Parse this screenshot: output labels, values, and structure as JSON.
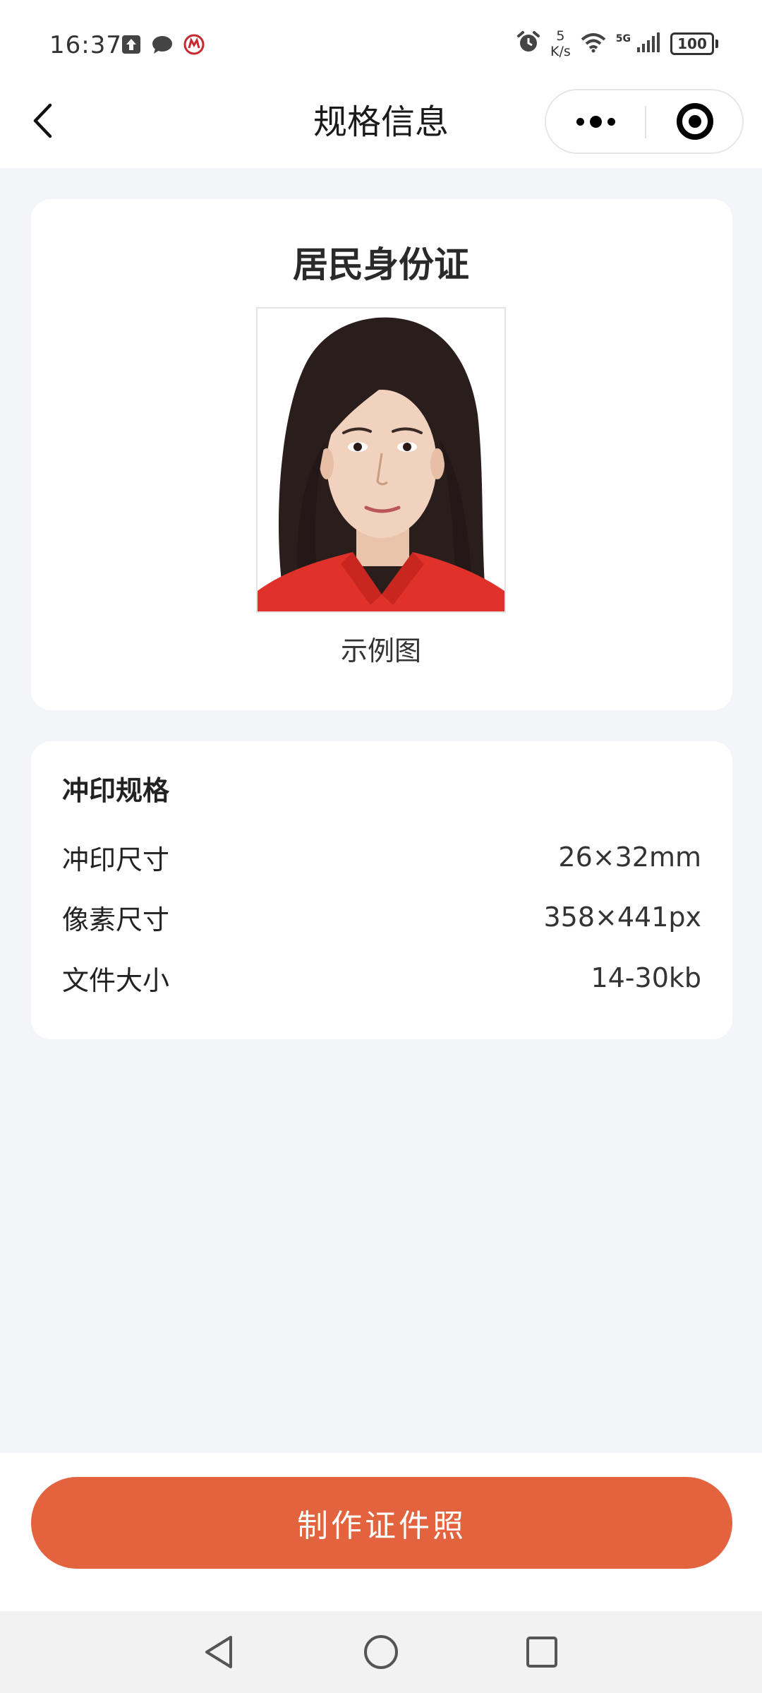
{
  "status_bar": {
    "time": "16:37",
    "net_speed_value": "5",
    "net_speed_unit": "K/s",
    "network": "5G",
    "battery": "100",
    "icons_left": [
      "upload-icon",
      "chat-bubble-icon",
      "bank-app-icon"
    ],
    "icons_right": [
      "alarm-icon",
      "wifi-icon",
      "signal-icon",
      "battery-icon"
    ]
  },
  "header": {
    "title": "规格信息",
    "back_icon": "chevron-left-icon",
    "more_icon": "more-dots-icon",
    "close_icon": "target-icon"
  },
  "sample": {
    "title": "居民身份证",
    "caption": "示例图",
    "photo": "id-photo-sample"
  },
  "specs": {
    "heading": "冲印规格",
    "rows": [
      {
        "label": "冲印尺寸",
        "value": "26×32mm"
      },
      {
        "label": "像素尺寸",
        "value": "358×441px"
      },
      {
        "label": "文件大小",
        "value": "14-30kb"
      }
    ]
  },
  "action": {
    "make_label": "制作证件照"
  },
  "navbar": {
    "icons": [
      "back-triangle-icon",
      "home-circle-icon",
      "recents-square-icon"
    ]
  },
  "colors": {
    "accent": "#E4633F",
    "page_bg": "#F4F5F9",
    "card_bg": "#FFFFFF"
  }
}
